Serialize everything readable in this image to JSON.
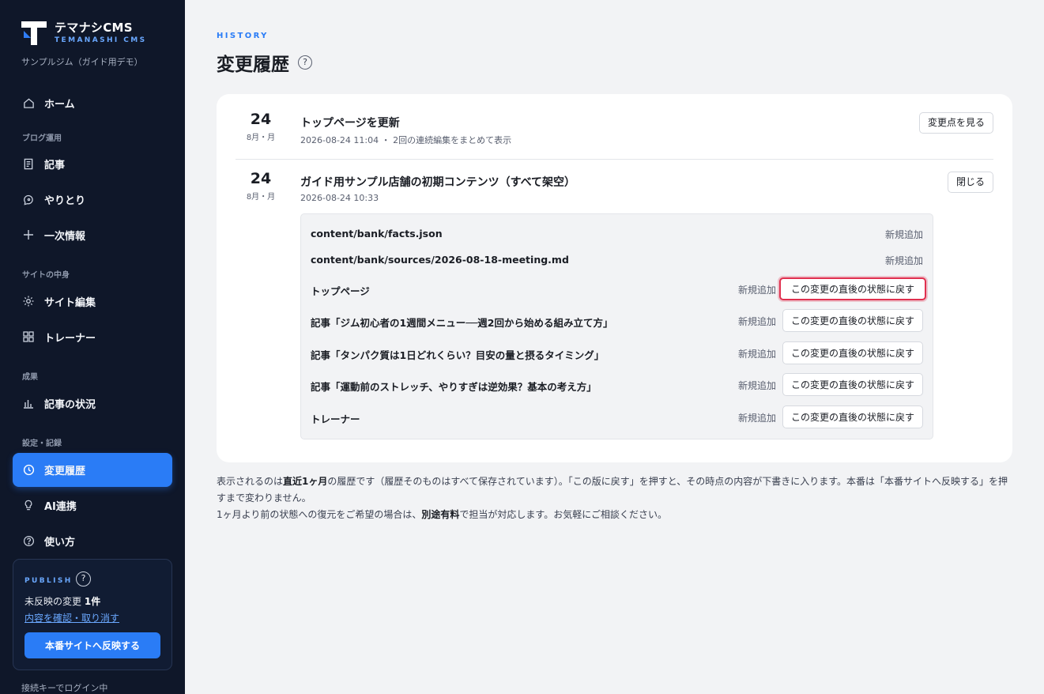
{
  "brand": {
    "title": "テマナシCMS",
    "subtitle": "TEMANASHI CMS",
    "site_name": "サンプルジム（ガイド用デモ）"
  },
  "nav": {
    "home": "ホーム",
    "section_blog": "ブログ運用",
    "articles": "記事",
    "conversations": "やりとり",
    "primary_info": "一次情報",
    "section_site": "サイトの中身",
    "site_edit": "サイト編集",
    "trainers": "トレーナー",
    "section_results": "成果",
    "article_status": "記事の状況",
    "section_settings": "設定・記録",
    "history": "変更履歴",
    "ai": "AI連携",
    "howto": "使い方"
  },
  "publish": {
    "tag": "PUBLISH",
    "help": "?",
    "pending_prefix": "未反映の変更",
    "pending_count": "1件",
    "review_link": "内容を確認・取り消す",
    "publish_button": "本番サイトへ反映する"
  },
  "login_note": "接続キーでログイン中",
  "page": {
    "eyebrow": "HISTORY",
    "title": "変更履歴",
    "help": "?"
  },
  "entries": [
    {
      "day": "24",
      "sub": "8月・月",
      "title": "トップページを更新",
      "meta": "2026-08-24 11:04 ・ 2回の連続編集をまとめて表示",
      "action": "変更点を見る"
    },
    {
      "day": "24",
      "sub": "8月・月",
      "title": "ガイド用サンプル店舗の初期コンテンツ（すべて架空）",
      "meta": "2026-08-24 10:33",
      "action": "閉じる"
    }
  ],
  "changes": [
    {
      "name": "content/bank/facts.json",
      "status": "新規追加"
    },
    {
      "name": "content/bank/sources/2026-08-18-meeting.md",
      "status": "新規追加"
    },
    {
      "name": "トップページ",
      "status": "新規追加",
      "revert": "この変更の直後の状態に戻す"
    },
    {
      "name": "記事「ジム初心者の1週間メニュー──週2回から始める組み立て方」",
      "status": "新規追加",
      "revert": "この変更の直後の状態に戻す"
    },
    {
      "name": "記事「タンパク質は1日どれくらい？目安の量と摂るタイミング」",
      "status": "新規追加",
      "revert": "この変更の直後の状態に戻す"
    },
    {
      "name": "記事「運動前のストレッチ、やりすぎは逆効果？基本の考え方」",
      "status": "新規追加",
      "revert": "この変更の直後の状態に戻す"
    },
    {
      "name": "トレーナー",
      "status": "新規追加",
      "revert": "この変更の直後の状態に戻す"
    }
  ],
  "footnote": {
    "p1_a": "表示されるのは",
    "p1_b": "直近1ヶ月",
    "p1_c": "の履歴です（履歴そのものはすべて保存されています）。「この版に戻す」を押すと、その時点の内容が下書きに入ります。本番は「本番サイトへ反映する」を押すまで変わりません。",
    "p2_a": "1ヶ月より前の状態への復元をご希望の場合は、",
    "p2_b": "別途有料",
    "p2_c": "で担当が対応します。お気軽にご相談ください。"
  }
}
